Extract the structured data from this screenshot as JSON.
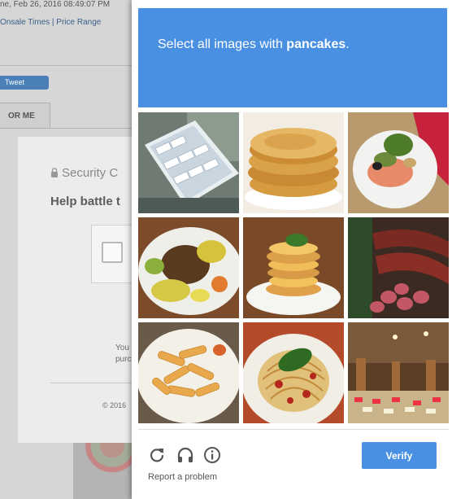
{
  "background": {
    "top_text": "ne, Feb 26, 2016 08:49:07 PM",
    "links": "Onsale Times | Price Range",
    "tweet_label": "Tweet",
    "tab_label": "OR ME"
  },
  "security_card": {
    "title": "Security C",
    "help_text": "Help battle t",
    "body_line1": "You",
    "body_line2": "purc",
    "copyright": "© 2016"
  },
  "challenge": {
    "prompt_prefix": "Select all images with ",
    "prompt_target": "pancakes",
    "prompt_suffix": ".",
    "header_color": "#4a90e2",
    "tiles": [
      {
        "subject": "cake-tray"
      },
      {
        "subject": "pancake-stack"
      },
      {
        "subject": "salmon-plate"
      },
      {
        "subject": "meat-plate"
      },
      {
        "subject": "small-pancake-stack"
      },
      {
        "subject": "sausages"
      },
      {
        "subject": "pasta"
      },
      {
        "subject": "spaghetti"
      },
      {
        "subject": "buffet"
      }
    ],
    "footer": {
      "reload_icon": "reload-icon",
      "audio_icon": "headphones-icon",
      "info_icon": "info-icon",
      "report_label": "Report a problem",
      "verify_label": "Verify"
    }
  }
}
